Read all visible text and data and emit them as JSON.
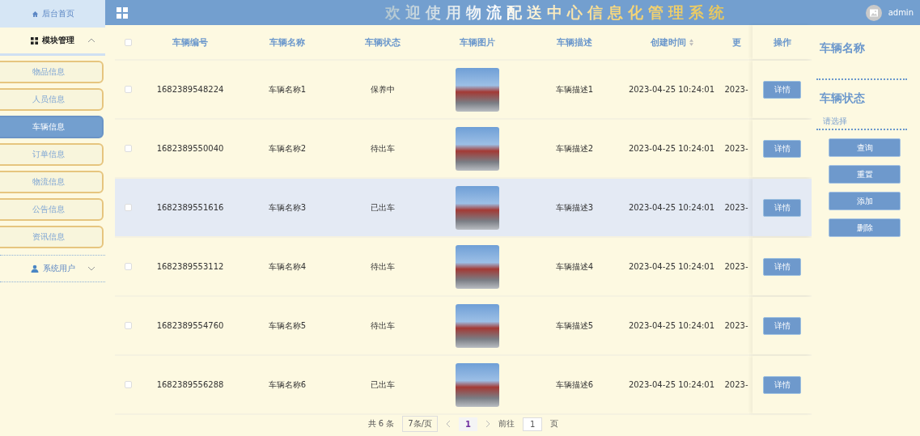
{
  "header": {
    "title": "欢迎使用物流配送中心信息化管理系统",
    "user": "admin"
  },
  "sidebar": {
    "home": "后台首页",
    "groups": [
      {
        "label": "模块管理",
        "expanded": true,
        "items": [
          {
            "label": "物品信息",
            "selected": false
          },
          {
            "label": "人员信息",
            "selected": false
          },
          {
            "label": "车辆信息",
            "selected": true
          },
          {
            "label": "订单信息",
            "selected": false
          },
          {
            "label": "物流信息",
            "selected": false
          },
          {
            "label": "公告信息",
            "selected": false
          },
          {
            "label": "资讯信息",
            "selected": false
          }
        ]
      },
      {
        "label": "系统用户",
        "expanded": false
      }
    ]
  },
  "table": {
    "all_checked": false,
    "columns": [
      "车辆编号",
      "车辆名称",
      "车辆状态",
      "车辆图片",
      "车辆描述",
      "创建时间",
      "更"
    ],
    "action_column": "操作",
    "rows": [
      {
        "checked": false,
        "hovered": false,
        "id": "1682389548224",
        "name": "车辆名称1",
        "status": "保养中",
        "description": "车辆描述1",
        "created": "2023-04-25 10:24:01",
        "column_8": "2023-",
        "action": "详情"
      },
      {
        "checked": false,
        "hovered": false,
        "id": "1682389550040",
        "name": "车辆名称2",
        "status": "待出车",
        "description": "车辆描述2",
        "created": "2023-04-25 10:24:01",
        "column_8": "2023-",
        "action": "详情"
      },
      {
        "checked": false,
        "hovered": true,
        "id": "1682389551616",
        "name": "车辆名称3",
        "status": "已出车",
        "description": "车辆描述3",
        "created": "2023-04-25 10:24:01",
        "column_8": "2023-",
        "action": "详情"
      },
      {
        "checked": false,
        "hovered": false,
        "id": "1682389553112",
        "name": "车辆名称4",
        "status": "待出车",
        "description": "车辆描述4",
        "created": "2023-04-25 10:24:01",
        "column_8": "2023-",
        "action": "详情"
      },
      {
        "checked": false,
        "hovered": false,
        "id": "1682389554760",
        "name": "车辆名称5",
        "status": "待出车",
        "description": "车辆描述5",
        "created": "2023-04-25 10:24:01",
        "column_8": "2023-",
        "action": "详情"
      },
      {
        "checked": false,
        "hovered": false,
        "id": "1682389556288",
        "name": "车辆名称6",
        "status": "已出车",
        "description": "车辆描述6",
        "created": "2023-04-25 10:24:01",
        "column_8": "2023-",
        "action": "详情"
      }
    ]
  },
  "pagination": {
    "total": "共 6 条",
    "page_size": "7条/页",
    "pages": [
      {
        "label": "1",
        "selected": true
      }
    ],
    "goto_label": "前往",
    "goto_value": "1",
    "goto_suffix": "页"
  },
  "search": {
    "name_label": "车辆名称",
    "status_label": "车辆状态",
    "status_placeholder": "请选择",
    "buttons": [
      "查询",
      "重置",
      "添加",
      "删除"
    ]
  }
}
